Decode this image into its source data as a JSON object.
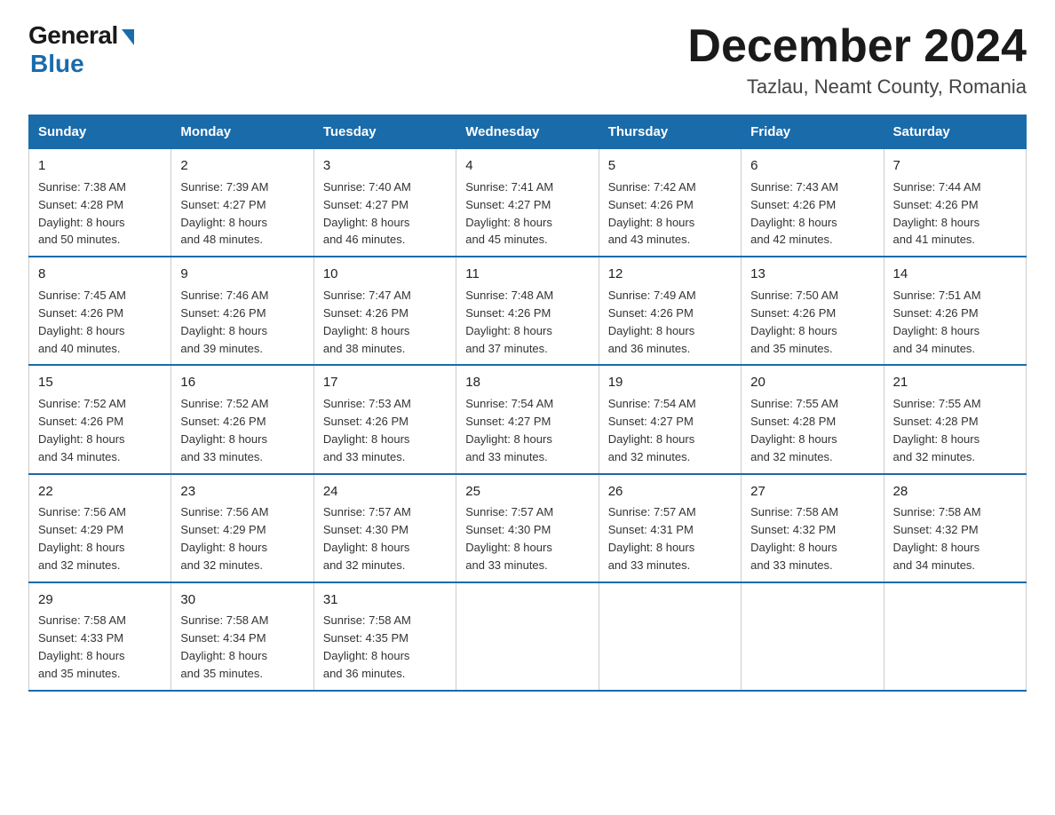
{
  "logo": {
    "general": "General",
    "blue": "Blue"
  },
  "title": "December 2024",
  "subtitle": "Tazlau, Neamt County, Romania",
  "days_of_week": [
    "Sunday",
    "Monday",
    "Tuesday",
    "Wednesday",
    "Thursday",
    "Friday",
    "Saturday"
  ],
  "weeks": [
    [
      {
        "day": "1",
        "info": "Sunrise: 7:38 AM\nSunset: 4:28 PM\nDaylight: 8 hours\nand 50 minutes."
      },
      {
        "day": "2",
        "info": "Sunrise: 7:39 AM\nSunset: 4:27 PM\nDaylight: 8 hours\nand 48 minutes."
      },
      {
        "day": "3",
        "info": "Sunrise: 7:40 AM\nSunset: 4:27 PM\nDaylight: 8 hours\nand 46 minutes."
      },
      {
        "day": "4",
        "info": "Sunrise: 7:41 AM\nSunset: 4:27 PM\nDaylight: 8 hours\nand 45 minutes."
      },
      {
        "day": "5",
        "info": "Sunrise: 7:42 AM\nSunset: 4:26 PM\nDaylight: 8 hours\nand 43 minutes."
      },
      {
        "day": "6",
        "info": "Sunrise: 7:43 AM\nSunset: 4:26 PM\nDaylight: 8 hours\nand 42 minutes."
      },
      {
        "day": "7",
        "info": "Sunrise: 7:44 AM\nSunset: 4:26 PM\nDaylight: 8 hours\nand 41 minutes."
      }
    ],
    [
      {
        "day": "8",
        "info": "Sunrise: 7:45 AM\nSunset: 4:26 PM\nDaylight: 8 hours\nand 40 minutes."
      },
      {
        "day": "9",
        "info": "Sunrise: 7:46 AM\nSunset: 4:26 PM\nDaylight: 8 hours\nand 39 minutes."
      },
      {
        "day": "10",
        "info": "Sunrise: 7:47 AM\nSunset: 4:26 PM\nDaylight: 8 hours\nand 38 minutes."
      },
      {
        "day": "11",
        "info": "Sunrise: 7:48 AM\nSunset: 4:26 PM\nDaylight: 8 hours\nand 37 minutes."
      },
      {
        "day": "12",
        "info": "Sunrise: 7:49 AM\nSunset: 4:26 PM\nDaylight: 8 hours\nand 36 minutes."
      },
      {
        "day": "13",
        "info": "Sunrise: 7:50 AM\nSunset: 4:26 PM\nDaylight: 8 hours\nand 35 minutes."
      },
      {
        "day": "14",
        "info": "Sunrise: 7:51 AM\nSunset: 4:26 PM\nDaylight: 8 hours\nand 34 minutes."
      }
    ],
    [
      {
        "day": "15",
        "info": "Sunrise: 7:52 AM\nSunset: 4:26 PM\nDaylight: 8 hours\nand 34 minutes."
      },
      {
        "day": "16",
        "info": "Sunrise: 7:52 AM\nSunset: 4:26 PM\nDaylight: 8 hours\nand 33 minutes."
      },
      {
        "day": "17",
        "info": "Sunrise: 7:53 AM\nSunset: 4:26 PM\nDaylight: 8 hours\nand 33 minutes."
      },
      {
        "day": "18",
        "info": "Sunrise: 7:54 AM\nSunset: 4:27 PM\nDaylight: 8 hours\nand 33 minutes."
      },
      {
        "day": "19",
        "info": "Sunrise: 7:54 AM\nSunset: 4:27 PM\nDaylight: 8 hours\nand 32 minutes."
      },
      {
        "day": "20",
        "info": "Sunrise: 7:55 AM\nSunset: 4:28 PM\nDaylight: 8 hours\nand 32 minutes."
      },
      {
        "day": "21",
        "info": "Sunrise: 7:55 AM\nSunset: 4:28 PM\nDaylight: 8 hours\nand 32 minutes."
      }
    ],
    [
      {
        "day": "22",
        "info": "Sunrise: 7:56 AM\nSunset: 4:29 PM\nDaylight: 8 hours\nand 32 minutes."
      },
      {
        "day": "23",
        "info": "Sunrise: 7:56 AM\nSunset: 4:29 PM\nDaylight: 8 hours\nand 32 minutes."
      },
      {
        "day": "24",
        "info": "Sunrise: 7:57 AM\nSunset: 4:30 PM\nDaylight: 8 hours\nand 32 minutes."
      },
      {
        "day": "25",
        "info": "Sunrise: 7:57 AM\nSunset: 4:30 PM\nDaylight: 8 hours\nand 33 minutes."
      },
      {
        "day": "26",
        "info": "Sunrise: 7:57 AM\nSunset: 4:31 PM\nDaylight: 8 hours\nand 33 minutes."
      },
      {
        "day": "27",
        "info": "Sunrise: 7:58 AM\nSunset: 4:32 PM\nDaylight: 8 hours\nand 33 minutes."
      },
      {
        "day": "28",
        "info": "Sunrise: 7:58 AM\nSunset: 4:32 PM\nDaylight: 8 hours\nand 34 minutes."
      }
    ],
    [
      {
        "day": "29",
        "info": "Sunrise: 7:58 AM\nSunset: 4:33 PM\nDaylight: 8 hours\nand 35 minutes."
      },
      {
        "day": "30",
        "info": "Sunrise: 7:58 AM\nSunset: 4:34 PM\nDaylight: 8 hours\nand 35 minutes."
      },
      {
        "day": "31",
        "info": "Sunrise: 7:58 AM\nSunset: 4:35 PM\nDaylight: 8 hours\nand 36 minutes."
      },
      {
        "day": "",
        "info": ""
      },
      {
        "day": "",
        "info": ""
      },
      {
        "day": "",
        "info": ""
      },
      {
        "day": "",
        "info": ""
      }
    ]
  ]
}
